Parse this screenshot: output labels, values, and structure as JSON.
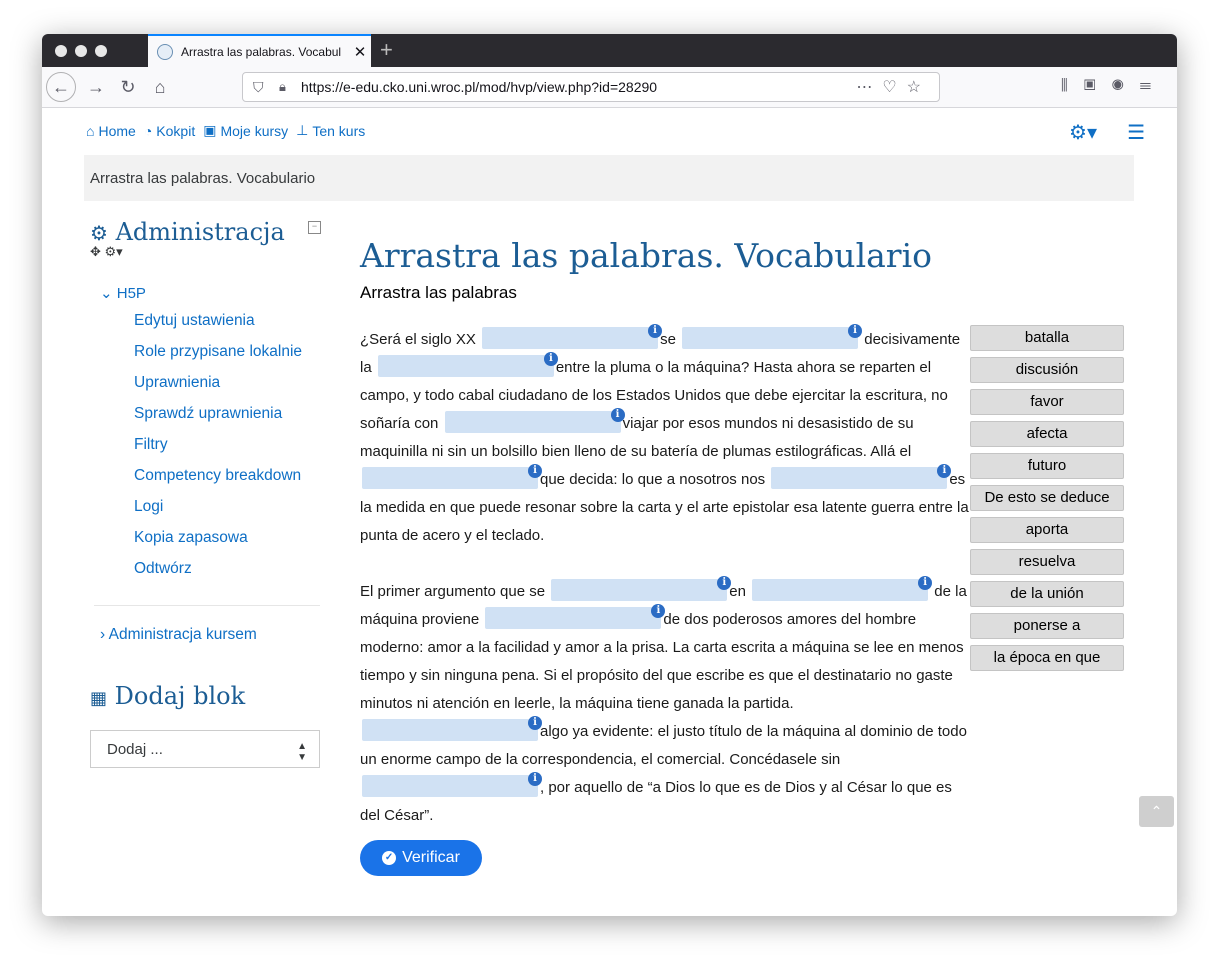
{
  "browser": {
    "tab_title": "Arrastra las palabras. Vocabul",
    "url": "https://e-edu.cko.uni.wroc.pl/mod/hvp/view.php?id=28290",
    "new_tab": "+"
  },
  "topnav": {
    "home": "Home",
    "kokpit": "Kokpit",
    "moje_kursy": "Moje kursy",
    "ten_kurs": "Ten kurs"
  },
  "breadcrumb": "Arrastra las palabras. Vocabulario",
  "sidebar": {
    "admin_title": "Administracja",
    "h5p_label": "H5P",
    "items": [
      {
        "label": "Edytuj ustawienia"
      },
      {
        "label": "Role przypisane lokalnie"
      },
      {
        "label": "Uprawnienia"
      },
      {
        "label": "Sprawdź uprawnienia"
      },
      {
        "label": "Filtry"
      },
      {
        "label": "Competency breakdown"
      },
      {
        "label": "Logi"
      },
      {
        "label": "Kopia zapasowa"
      },
      {
        "label": "Odtwórz"
      }
    ],
    "course_admin": "Administracja kursem",
    "add_block_title": "Dodaj blok",
    "add_block_select": "Dodaj ..."
  },
  "main": {
    "title": "Arrastra las palabras. Vocabulario",
    "subtitle": "Arrastra las palabras",
    "p1": [
      "¿Será el siglo XX ",
      "se ",
      "decisivamente la ",
      "entre la pluma o la máquina? Hasta ahora se reparten el campo, y todo cabal ciudadano de los Estados Unidos que debe ejercitar la escritura, no soñaría con ",
      "viajar por esos mundos ni desasistido de su maquinilla ni sin un bolsillo bien lleno de su batería de plumas estilográficas. Allá el ",
      "que decida: lo que a nosotros nos ",
      "es la medida en que puede resonar sobre la carta y el arte epistolar esa latente guerra entre la punta de acero y el teclado."
    ],
    "p2": [
      "El primer argumento que se ",
      "en ",
      "de la máquina proviene ",
      "de dos poderosos amores del hombre moderno: amor a la facilidad y amor a la prisa. La carta escrita a máquina se lee en menos tiempo y sin ninguna pena. Si el propósito del que escribe es que el destinatario no gaste minutos ni atención en leerle, la máquina tiene ganada la partida. ",
      "algo ya evidente: el justo título de la máquina al dominio de todo un enorme campo de la correspondencia, el comercial. Concédasele sin ",
      ", por aquello de “a Dios lo que es de Dios y al César lo que es del César”."
    ],
    "info_glyph": "i",
    "words": [
      "batalla",
      "discusión",
      "favor",
      "afecta",
      "futuro",
      "De esto se deduce",
      "aporta",
      "resuelva",
      "de la unión",
      "ponerse a",
      "la época en que"
    ],
    "verify_label": "Verificar"
  }
}
